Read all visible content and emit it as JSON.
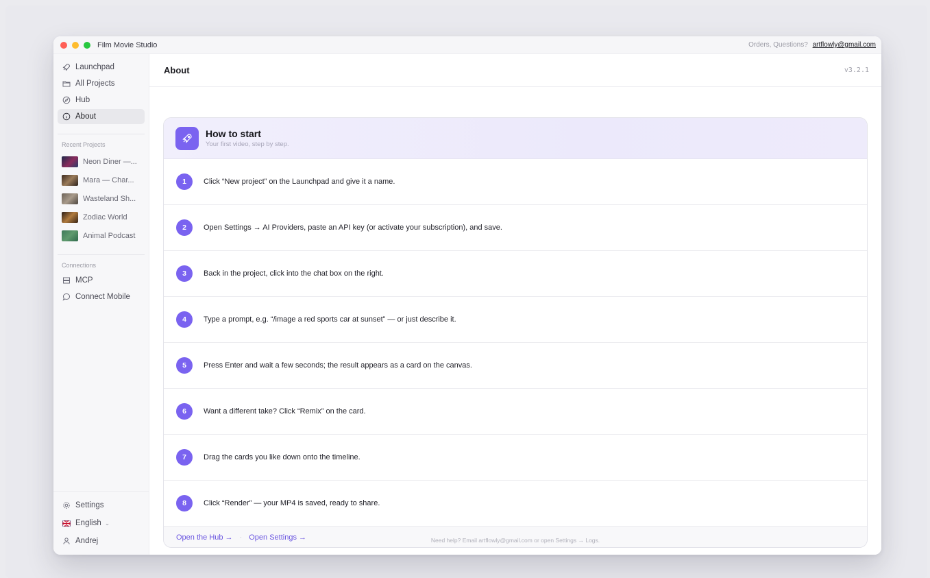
{
  "window": {
    "app_title": "Film Movie Studio",
    "contact_prefix": "Orders, Questions?",
    "contact_email": "artflowly@gmail.com"
  },
  "sidebar": {
    "nav": [
      {
        "label": "Launchpad",
        "icon": "rocket-icon"
      },
      {
        "label": "All Projects",
        "icon": "folder-icon"
      },
      {
        "label": "Hub",
        "icon": "compass-icon"
      },
      {
        "label": "About",
        "icon": "info-icon",
        "active": true
      }
    ],
    "recent_title": "Recent Projects",
    "recent": [
      {
        "label": "Neon Diner —..."
      },
      {
        "label": "Mara — Char..."
      },
      {
        "label": "Wasteland Sh..."
      },
      {
        "label": "Zodiac World"
      },
      {
        "label": "Animal Podcast"
      }
    ],
    "connections_title": "Connections",
    "connections": [
      {
        "label": "MCP",
        "icon": "server-icon"
      },
      {
        "label": "Connect Mobile",
        "icon": "chat-bubble-icon"
      }
    ],
    "bottom": [
      {
        "label": "Settings",
        "icon": "gear-icon"
      },
      {
        "label": "English",
        "icon": "flag-icon"
      },
      {
        "label": "Andrej",
        "icon": "user-icon"
      }
    ]
  },
  "main": {
    "title": "About",
    "version": "v3.2.1",
    "card": {
      "title": "How to start",
      "subtitle": "Your first video, step by step.",
      "steps": [
        {
          "num": "1",
          "text": "Click “New project” on the Launchpad and give it a name."
        },
        {
          "num": "2",
          "text": "Open Settings → AI Providers, paste an API key (or activate your subscription), and save."
        },
        {
          "num": "3",
          "text": "Back in the project, click into the chat box on the right."
        },
        {
          "num": "4",
          "text": "Type a prompt, e.g. “/image a red sports car at sunset” — or just describe it."
        },
        {
          "num": "5",
          "text": "Press Enter and wait a few seconds; the result appears as a card on the canvas."
        },
        {
          "num": "6",
          "text": "Want a different take? Click “Remix” on the card."
        },
        {
          "num": "7",
          "text": "Drag the cards you like down onto the timeline."
        },
        {
          "num": "8",
          "text": "Click “Render” — your MP4 is saved, ready to share."
        }
      ],
      "footer_links": [
        "Open the Hub →",
        "Open Settings →"
      ],
      "footer_separator": "·"
    },
    "help_text": "Need help? Email artflowly@gmail.com or open Settings → Logs."
  },
  "colors": {
    "accent": "#7a63f0",
    "link": "#6a55e0",
    "traffic_red": "#ff5f57",
    "traffic_yellow": "#febc2e",
    "traffic_green": "#28c840"
  }
}
